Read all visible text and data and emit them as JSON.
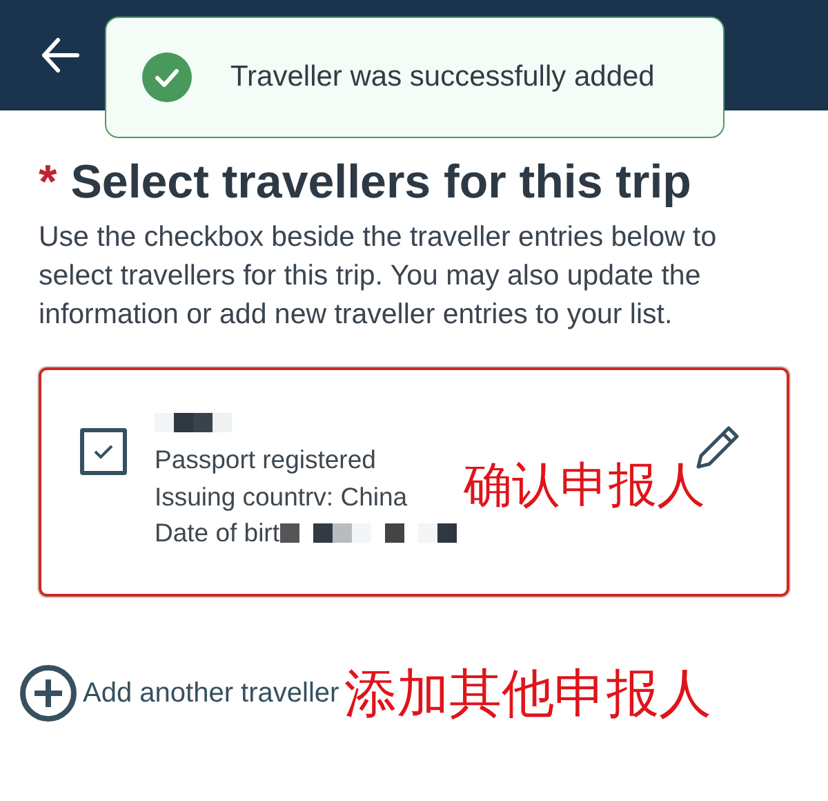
{
  "header": {
    "back": true
  },
  "toast": {
    "message": "Traveller was successfully added"
  },
  "heading": {
    "required_mark": "*",
    "title": "Select travellers for this trip"
  },
  "description": "Use the checkbox beside the traveller entries below to select travellers for this trip. You may also update the information or add new traveller entries to your list.",
  "travellers": [
    {
      "checked": true,
      "lines": [
        "Passport registered",
        "Issuing countrv: China",
        "Date of birt"
      ],
      "annotation": "确认申报人"
    }
  ],
  "add_link": {
    "label": "Add another traveller",
    "annotation": "添加其他申报人"
  }
}
